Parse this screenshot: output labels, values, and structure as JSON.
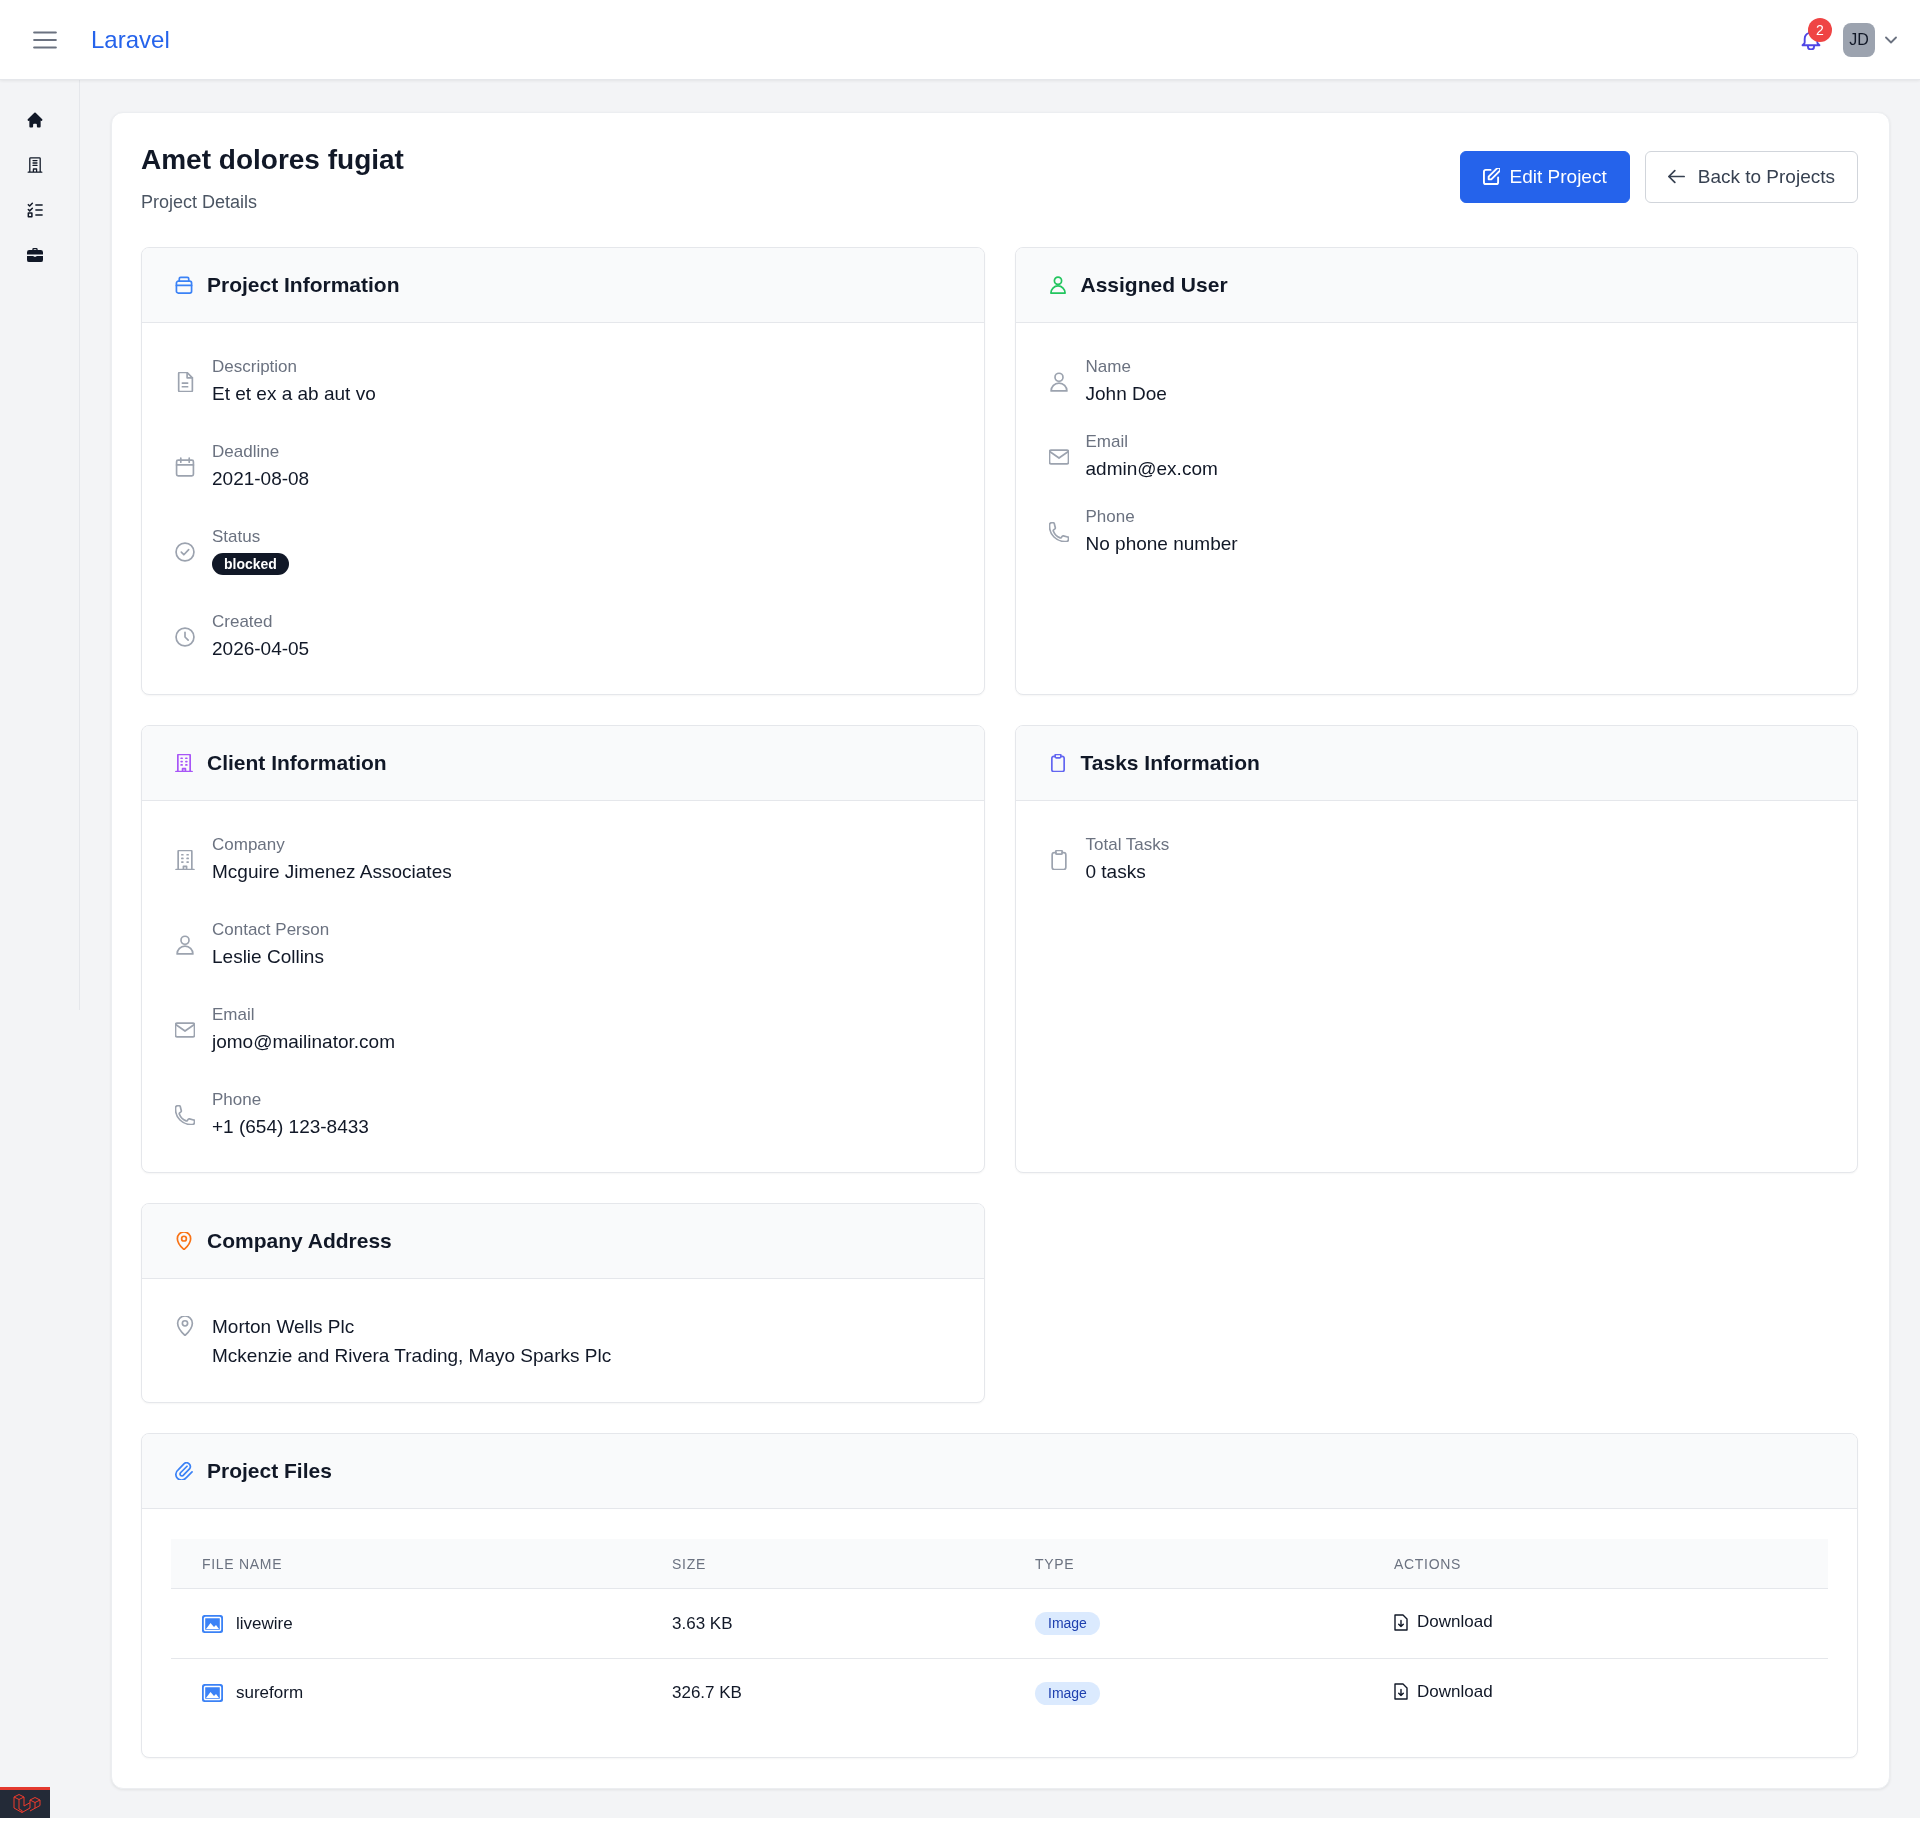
{
  "header": {
    "brand": "Laravel",
    "notifications": "2",
    "avatar": "JD"
  },
  "page": {
    "title": "Amet dolores fugiat",
    "subtitle": "Project Details",
    "actions": [
      {
        "kind": "edit",
        "label": "Edit Project"
      },
      {
        "kind": "back",
        "label": "Back to Projects"
      }
    ]
  },
  "sections": [
    {
      "kind": "project",
      "title": "Project Information",
      "fields": [
        {
          "kind": "description",
          "label": "Description",
          "value": "Et et ex a ab aut vo"
        },
        {
          "kind": "deadline",
          "label": "Deadline",
          "value": "2021-08-08"
        },
        {
          "kind": "status",
          "label": "Status",
          "value": "blocked"
        },
        {
          "kind": "created",
          "label": "Created",
          "value": "2026-04-05"
        }
      ]
    },
    {
      "kind": "user",
      "title": "Assigned User",
      "fields": [
        {
          "kind": "person",
          "label": "Name",
          "value": "John Doe"
        },
        {
          "kind": "email",
          "label": "Email",
          "value": "admin@ex.com"
        },
        {
          "kind": "phone",
          "label": "Phone",
          "value": "No phone number"
        }
      ]
    },
    {
      "kind": "client",
      "title": "Client Information",
      "fields": [
        {
          "kind": "company",
          "label": "Company",
          "value": "Mcguire Jimenez Associates"
        },
        {
          "kind": "person",
          "label": "Contact Person",
          "value": "Leslie Collins"
        },
        {
          "kind": "email",
          "label": "Email",
          "value": "jomo@mailinator.com"
        },
        {
          "kind": "phone",
          "label": "Phone",
          "value": "+1 (654) 123-8433"
        }
      ]
    },
    {
      "kind": "tasks",
      "title": "Tasks Information",
      "fields": [
        {
          "kind": "tasks",
          "label": "Total Tasks",
          "value": "0 tasks"
        }
      ]
    },
    {
      "kind": "address",
      "title": "Company Address",
      "fields": [
        {
          "kind": "address",
          "lines": [
            "Morton Wells Plc",
            "Mckenzie and Rivera Trading, Mayo Sparks Plc"
          ]
        }
      ]
    }
  ],
  "files": {
    "title": "Project Files",
    "columns": [
      "FILE NAME",
      "SIZE",
      "TYPE",
      "ACTIONS"
    ],
    "rows": [
      {
        "name": "livewire",
        "size": "3.63 KB",
        "type": "Image",
        "action": "Download"
      },
      {
        "name": "sureform",
        "size": "326.7 KB",
        "type": "Image",
        "action": "Download"
      }
    ]
  }
}
